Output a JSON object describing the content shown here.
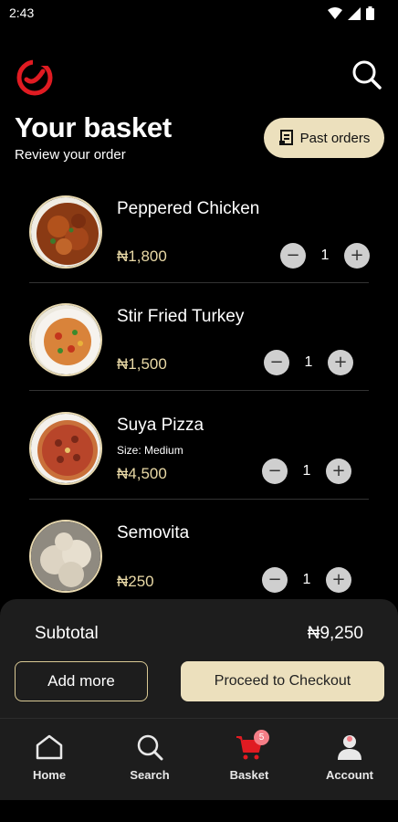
{
  "status": {
    "time": "2:43"
  },
  "header": {
    "title": "Your basket",
    "subtitle": "Review your order",
    "past_orders_label": "Past orders",
    "accent": "#e01b22"
  },
  "items": [
    {
      "name": "Peppered Chicken",
      "size": "",
      "price": "₦1,800",
      "quantity": "1",
      "image": "peppered-chicken"
    },
    {
      "name": "Stir Fried Turkey",
      "size": "",
      "price": "₦1,500",
      "quantity": "1",
      "image": "stir-fried-turkey"
    },
    {
      "name": "Suya Pizza",
      "size": "Size: Medium",
      "price": "₦4,500",
      "quantity": "1",
      "image": "suya-pizza"
    },
    {
      "name": "Semovita",
      "size": "",
      "price": "₦250",
      "quantity": "1",
      "image": "semovita"
    }
  ],
  "summary": {
    "subtotal_label": "Subtotal",
    "subtotal_value": "₦9,250",
    "add_more_label": "Add more",
    "checkout_label": "Proceed to Checkout"
  },
  "nav": {
    "items": [
      {
        "label": "Home",
        "icon": "home-icon"
      },
      {
        "label": "Search",
        "icon": "search-icon"
      },
      {
        "label": "Basket",
        "icon": "cart-icon",
        "badge": "5"
      },
      {
        "label": "Account",
        "icon": "account-icon"
      }
    ]
  }
}
